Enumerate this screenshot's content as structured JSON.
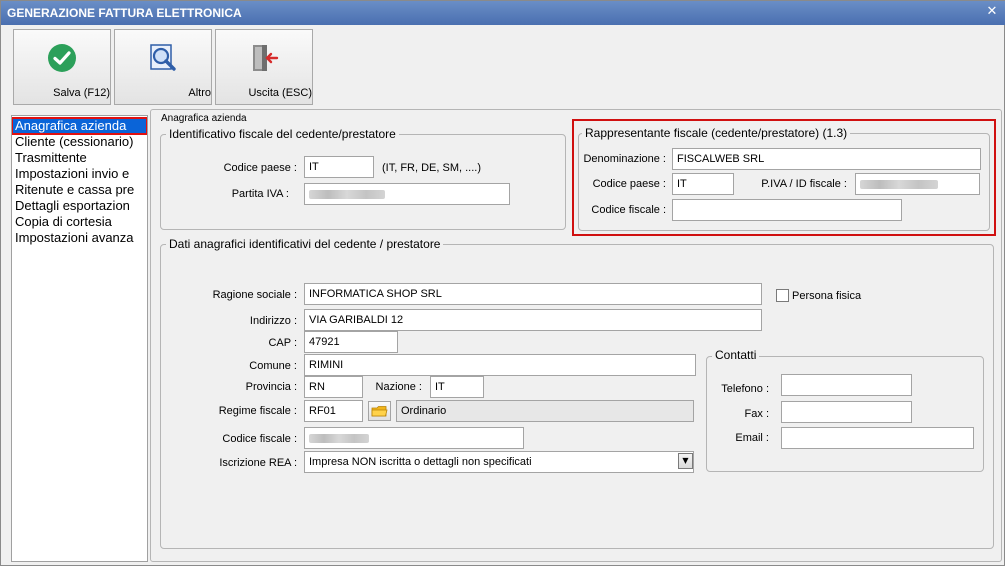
{
  "window": {
    "title": "GENERAZIONE FATTURA ELETTRONICA",
    "close_glyph": "✕"
  },
  "toolbar": {
    "save": {
      "label": "Salva (F12)",
      "icon": "check-circle-icon",
      "color": "#2ca05a"
    },
    "other": {
      "label": "Altro",
      "icon": "magnifier-document-icon"
    },
    "exit": {
      "label": "Uscita (ESC)",
      "icon": "exit-door-icon",
      "arrow_color": "#d62b2b"
    }
  },
  "sidebar": {
    "items": [
      {
        "label": "Anagrafica azienda"
      },
      {
        "label": "Cliente (cessionario)"
      },
      {
        "label": "Trasmittente"
      },
      {
        "label": "Impostazioni invio e"
      },
      {
        "label": "Ritenute e cassa pre"
      },
      {
        "label": "Dettagli esportazion"
      },
      {
        "label": "Copia di cortesia"
      },
      {
        "label": "Impostazioni avanza"
      }
    ]
  },
  "panel": {
    "legend": "Anagrafica azienda",
    "fiscal_id": {
      "legend": "Identificativo fiscale del cedente/prestatore",
      "country_label": "Codice paese :",
      "country_value": "IT",
      "country_hint": "(IT, FR, DE, SM, ....)",
      "vat_label": "Partita IVA :"
    },
    "rep": {
      "legend": "Rappresentante fiscale (cedente/prestatore) (1.3)",
      "name_label": "Denominazione :",
      "name_value": "FISCALWEB SRL",
      "country_label": "Codice paese :",
      "country_value": "IT",
      "vat_label": "P.IVA / ID fiscale :",
      "taxcode_label": "Codice fiscale :",
      "taxcode_value": ""
    },
    "registry": {
      "legend": "Dati anagrafici identificativi del cedente / prestatore",
      "company_label": "Ragione sociale :",
      "company_value": "INFORMATICA SHOP SRL",
      "person_label": "Persona fisica",
      "address_label": "Indirizzo :",
      "address_value": "VIA GARIBALDI 12",
      "cap_label": "CAP :",
      "cap_value": "47921",
      "city_label": "Comune :",
      "city_value": "RIMINI",
      "province_label": "Provincia :",
      "province_value": "RN",
      "nation_label": "Nazione :",
      "nation_value": "IT",
      "regime_label": "Regime fiscale :",
      "regime_code": "RF01",
      "regime_desc": "Ordinario",
      "taxcode_label": "Codice fiscale :",
      "rea_label": "Iscrizione REA :",
      "rea_value": "Impresa NON iscritta o dettagli non specificati"
    },
    "contacts": {
      "legend": "Contatti",
      "phone_label": "Telefono :",
      "phone_value": "",
      "fax_label": "Fax :",
      "fax_value": "",
      "email_label": "Email :",
      "email_value": ""
    }
  }
}
